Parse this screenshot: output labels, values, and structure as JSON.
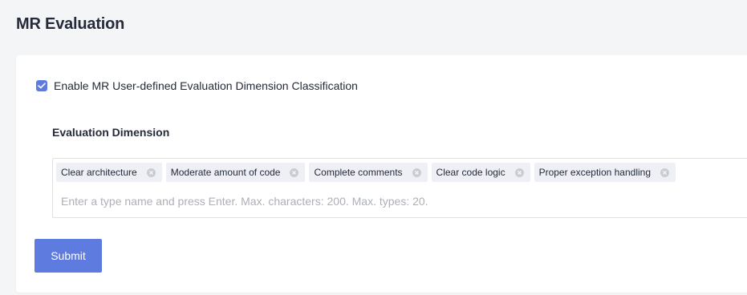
{
  "page": {
    "title": "MR Evaluation"
  },
  "settings": {
    "enable_checkbox": {
      "checked": true,
      "label": "Enable MR User-defined Evaluation Dimension Classification"
    },
    "dimension_label": "Evaluation Dimension",
    "tags": [
      "Clear architecture",
      "Moderate amount of code",
      "Complete comments",
      "Clear code logic",
      "Proper exception handling"
    ],
    "tag_input_placeholder": "Enter a type name and press Enter. Max. characters: 200. Max. types: 20.",
    "submit_label": "Submit"
  },
  "colors": {
    "accent": "#5e7ce0",
    "tag_bg": "#eef0f5",
    "page_bg": "#f4f5f7"
  }
}
